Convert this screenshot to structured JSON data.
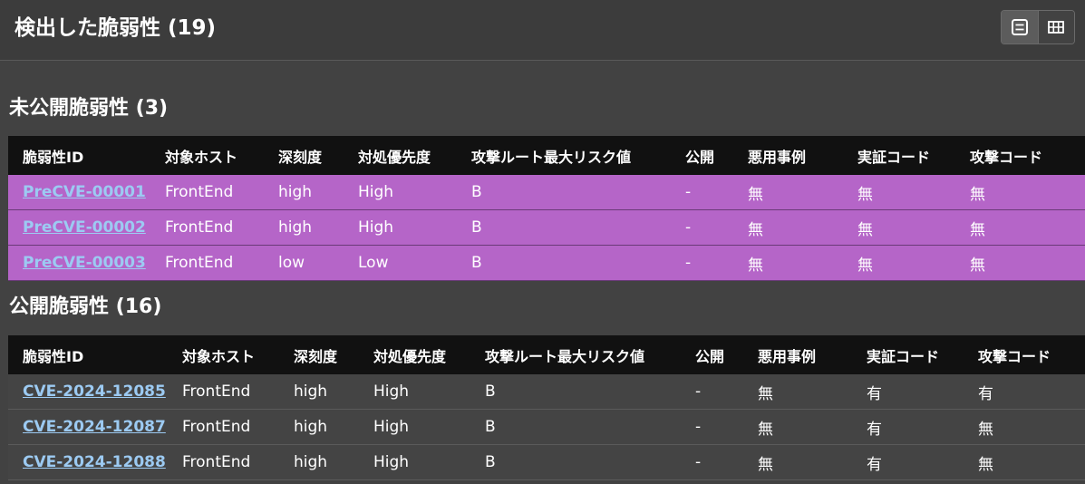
{
  "header": {
    "title": "検出した脆弱性 (19)",
    "view_modes": [
      {
        "name": "list-view",
        "active": true
      },
      {
        "name": "grid-view",
        "active": false
      }
    ]
  },
  "columns": [
    "脆弱性ID",
    "対象ホスト",
    "深刻度",
    "対処優先度",
    "攻撃ルート最大リスク値",
    "公開",
    "悪用事例",
    "実証コード",
    "攻撃コード"
  ],
  "unpublished": {
    "title": "未公開脆弱性 (3)",
    "row_color": "#b565c8",
    "rows": [
      [
        "PreCVE-00001",
        "FrontEnd",
        "high",
        "High",
        "B",
        "-",
        "無",
        "無",
        "無"
      ],
      [
        "PreCVE-00002",
        "FrontEnd",
        "high",
        "High",
        "B",
        "-",
        "無",
        "無",
        "無"
      ],
      [
        "PreCVE-00003",
        "FrontEnd",
        "low",
        "Low",
        "B",
        "-",
        "無",
        "無",
        "無"
      ]
    ]
  },
  "published": {
    "title": "公開脆弱性 (16)",
    "rows": [
      [
        "CVE-2024-12085",
        "FrontEnd",
        "high",
        "High",
        "B",
        "-",
        "無",
        "有",
        "有"
      ],
      [
        "CVE-2024-12087",
        "FrontEnd",
        "high",
        "High",
        "B",
        "-",
        "無",
        "有",
        "無"
      ],
      [
        "CVE-2024-12088",
        "FrontEnd",
        "high",
        "High",
        "B",
        "-",
        "無",
        "有",
        "無"
      ]
    ]
  },
  "colors": {
    "background": "#424242",
    "header_row": "#111111",
    "link": "#9ccaf2"
  }
}
